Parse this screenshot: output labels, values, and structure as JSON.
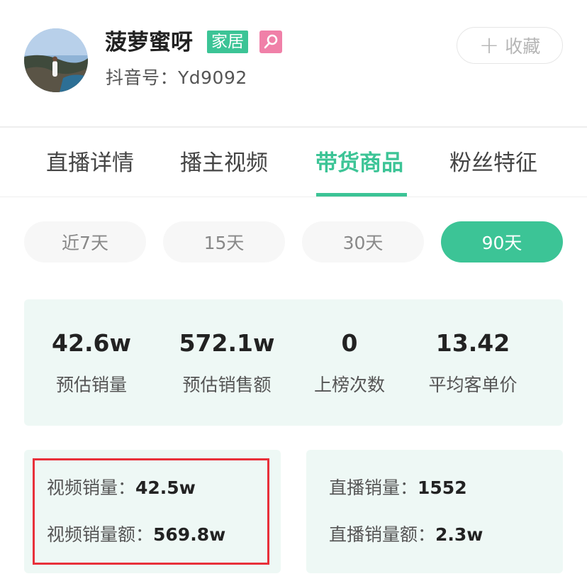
{
  "profile": {
    "name": "菠萝蜜呀",
    "category_tag": "家居",
    "gender_icon": "female-icon",
    "douyin_id_label": "抖音号：",
    "douyin_id": "Yd9092",
    "fav_icon": "plus-icon",
    "fav_label": "收藏"
  },
  "tabs": [
    {
      "label": "直播详情",
      "active": false
    },
    {
      "label": "播主视频",
      "active": false
    },
    {
      "label": "带货商品",
      "active": true
    },
    {
      "label": "粉丝特征",
      "active": false
    }
  ],
  "periods": [
    {
      "label": "近7天",
      "active": false
    },
    {
      "label": "15天",
      "active": false
    },
    {
      "label": "30天",
      "active": false
    },
    {
      "label": "90天",
      "active": true
    }
  ],
  "stats": [
    {
      "value": "42.6w",
      "label": "预估销量"
    },
    {
      "value": "572.1w",
      "label": "预估销售额"
    },
    {
      "value": "0",
      "label": "上榜次数"
    },
    {
      "value": "13.42",
      "label": "平均客单价"
    }
  ],
  "video_card": {
    "sales_label": "视频销量：",
    "sales_value": "42.5w",
    "amount_label": "视频销量额：",
    "amount_value": "569.8w"
  },
  "live_card": {
    "sales_label": "直播销量：",
    "sales_value": "1552",
    "amount_label": "直播销量额：",
    "amount_value": "2.3w"
  },
  "colors": {
    "accent": "#3cc496",
    "card_bg": "#eef8f5",
    "gender_tag": "#f080a8",
    "highlight_box": "#e8303a"
  }
}
